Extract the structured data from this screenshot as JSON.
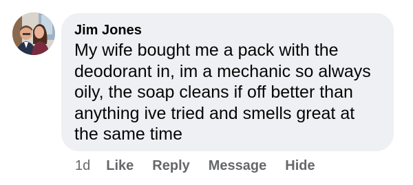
{
  "comment": {
    "avatar_icon": "profile-photo-avatar",
    "author": "Jim Jones",
    "text": "My wife bought me a pack with the\ndeodorant in, im a mechanic so always\noily,  the soap cleans if off better than\nanything ive tried and smells great at\nthe same time",
    "timestamp": "1d",
    "actions": {
      "like": "Like",
      "reply": "Reply",
      "message": "Message",
      "hide": "Hide"
    }
  },
  "colors": {
    "bubble_bg": "#eff0f3",
    "text": "#050505",
    "secondary_text": "#65676b"
  }
}
